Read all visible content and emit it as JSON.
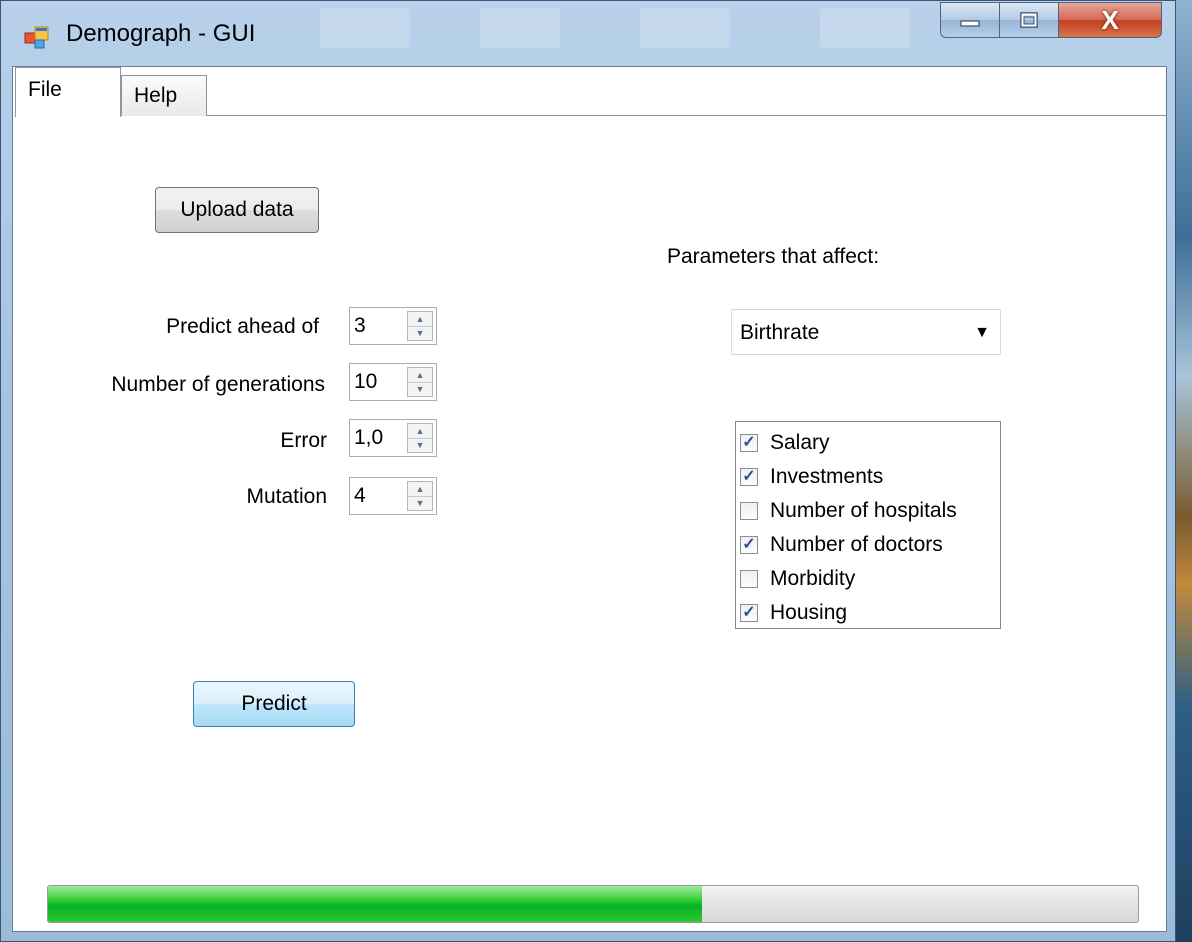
{
  "window": {
    "title": "Demograph - GUI",
    "controls": {
      "minimize": "minimize-icon",
      "maximize": "maximize-icon",
      "close": "X"
    }
  },
  "tabs": [
    {
      "label": "File",
      "active": true
    },
    {
      "label": "Help",
      "active": false
    }
  ],
  "upload": {
    "label": "Upload data"
  },
  "fields": [
    {
      "label": "Predict ahead of",
      "value": "3"
    },
    {
      "label": "Number of generations",
      "value": "10"
    },
    {
      "label": "Error",
      "value": "1,0"
    },
    {
      "label": "Mutation",
      "value": "4"
    }
  ],
  "predict": {
    "label": "Predict"
  },
  "params": {
    "label": "Parameters that affect:",
    "selected": "Birthrate",
    "options": [
      {
        "label": "Salary",
        "checked": true
      },
      {
        "label": "Investments",
        "checked": true
      },
      {
        "label": "Number of hospitals",
        "checked": false
      },
      {
        "label": "Number of doctors",
        "checked": true
      },
      {
        "label": "Morbidity",
        "checked": false
      },
      {
        "label": "Housing",
        "checked": true
      }
    ]
  },
  "progress": {
    "value": 0.6
  },
  "colors": {
    "accent": "#06b025",
    "selection_check": "#2a4d9b"
  }
}
